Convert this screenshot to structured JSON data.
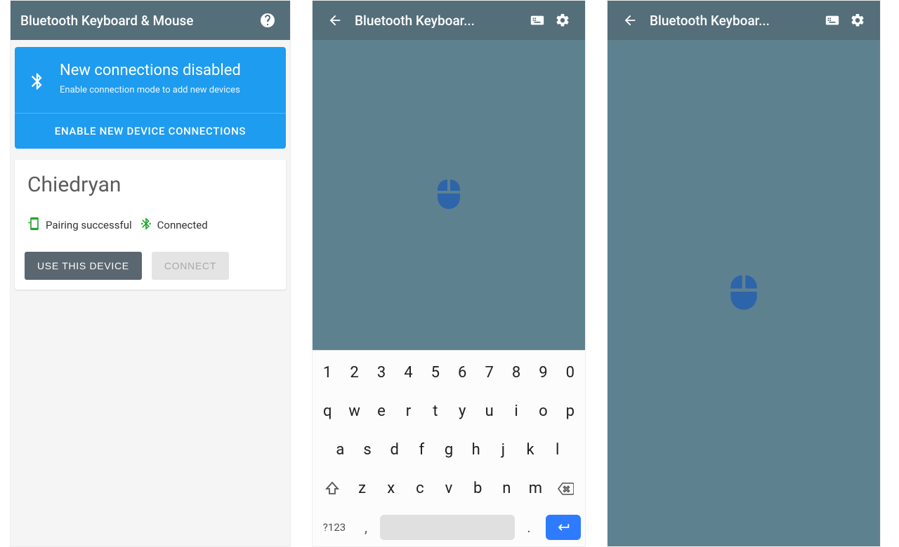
{
  "screen1": {
    "appbar": {
      "title": "Bluetooth Keyboard & Mouse"
    },
    "banner": {
      "title": "New connections disabled",
      "subtitle": "Enable connection mode to add new devices",
      "action": "ENABLE NEW DEVICE CONNECTIONS"
    },
    "device": {
      "name": "Chiedryan",
      "pair_status": "Pairing successful",
      "conn_status": "Connected",
      "use_btn": "USE THIS DEVICE",
      "connect_btn": "CONNECT"
    }
  },
  "screen2": {
    "appbar": {
      "title": "Bluetooth Keyboar..."
    },
    "keyboard": {
      "row0": [
        "1",
        "2",
        "3",
        "4",
        "5",
        "6",
        "7",
        "8",
        "9",
        "0"
      ],
      "row1": [
        "q",
        "w",
        "e",
        "r",
        "t",
        "y",
        "u",
        "i",
        "o",
        "p"
      ],
      "row2": [
        "a",
        "s",
        "d",
        "f",
        "g",
        "h",
        "j",
        "k",
        "l"
      ],
      "row3": [
        "z",
        "x",
        "c",
        "v",
        "b",
        "n",
        "m"
      ],
      "sym": "?123",
      "comma": ",",
      "period": "."
    }
  },
  "screen3": {
    "appbar": {
      "title": "Bluetooth Keyboar..."
    }
  },
  "colors": {
    "appbar": "#546e7a",
    "banner": "#1e9cf0",
    "trackpad": "#5d818f",
    "accent_mouse": "#2d64aa",
    "success": "#24a52f"
  }
}
